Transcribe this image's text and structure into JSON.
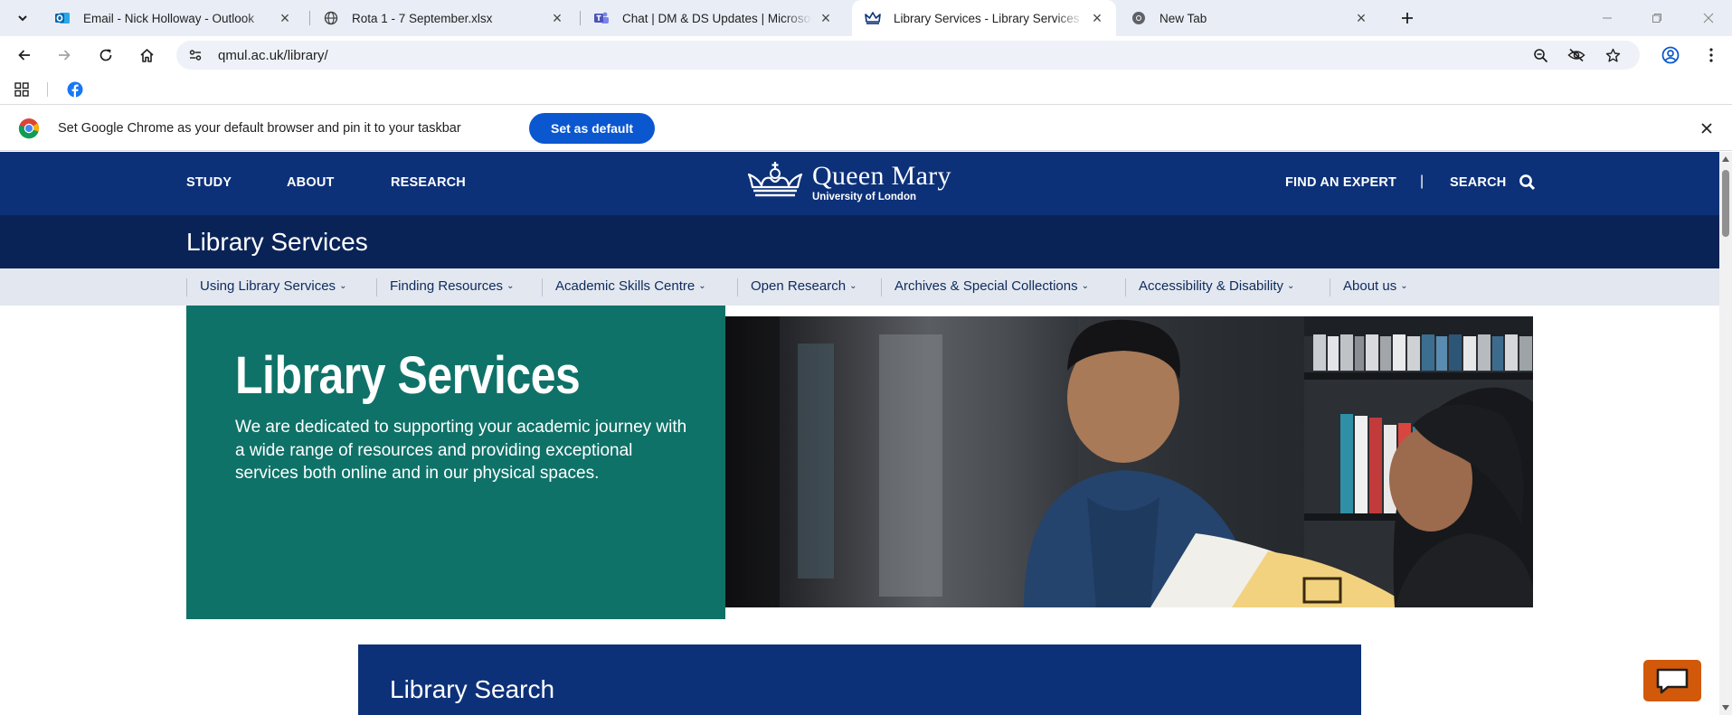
{
  "browser": {
    "tabs": [
      {
        "title": "Email - Nick Holloway - Outlook",
        "icon": "outlook-icon",
        "active": false
      },
      {
        "title": "Rota 1 - 7 September.xlsx",
        "icon": "globe-icon",
        "active": false
      },
      {
        "title": "Chat | DM & DS Updates | Microsoft Teams",
        "icon": "teams-icon",
        "active": false
      },
      {
        "title": "Library Services - Library Services",
        "icon": "qm-crown-icon",
        "active": true
      },
      {
        "title": "New Tab",
        "icon": "chrome-icon",
        "active": false
      }
    ],
    "url": "qmul.ac.uk/library/",
    "infobar": {
      "message": "Set Google Chrome as your default browser and pin it to your taskbar",
      "button": "Set as default"
    }
  },
  "site": {
    "top_nav": {
      "study": "STUDY",
      "about": "ABOUT",
      "research": "RESEARCH"
    },
    "logo": {
      "name": "Queen Mary",
      "subtitle": "University of London"
    },
    "utility_nav": {
      "find_expert": "FIND AN EXPERT",
      "divider": "|",
      "search": "SEARCH"
    },
    "section_title": "Library Services",
    "sub_nav": [
      "Using Library Services",
      "Finding Resources",
      "Academic Skills Centre",
      "Open Research",
      "Archives & Special Collections",
      "Accessibility & Disability",
      "About us"
    ],
    "hero": {
      "title": "Library Services",
      "text": "We are dedicated to supporting your academic journey with a wide range of resources and providing exceptional services both online and in our physical spaces."
    },
    "library_search": {
      "title": "Library Search"
    }
  },
  "colors": {
    "qm_navy": "#0d3179",
    "qm_dark_navy": "#0a2357",
    "hero_green": "#0f7268",
    "chrome_blue": "#0b57d0",
    "chat_orange": "#d2590a"
  }
}
